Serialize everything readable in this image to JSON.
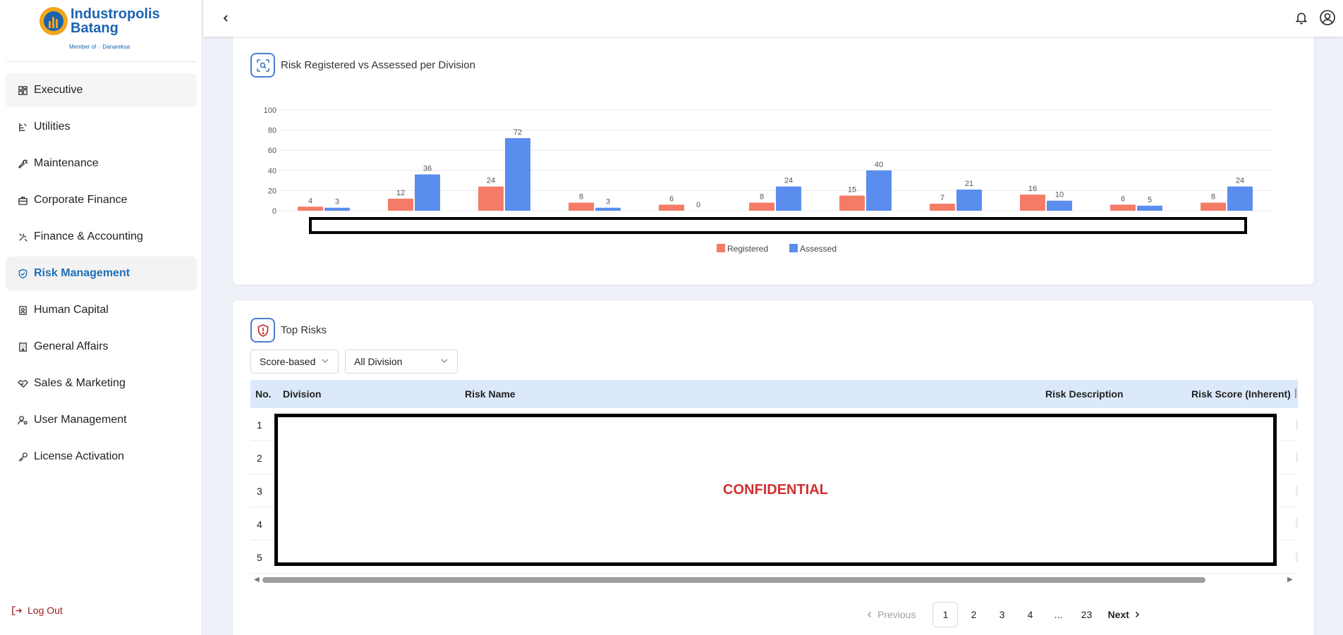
{
  "brand": {
    "name_line1": "Industropolis",
    "name_line2": "Batang",
    "member_of": "Member of ◌ Danareksa"
  },
  "sidebar": {
    "items": [
      {
        "label": "Executive",
        "icon": "grid-icon"
      },
      {
        "label": "Utilities",
        "icon": "utilities-icon"
      },
      {
        "label": "Maintenance",
        "icon": "wrench-icon"
      },
      {
        "label": "Corporate Finance",
        "icon": "briefcase-icon"
      },
      {
        "label": "Finance & Accounting",
        "icon": "tools-icon"
      },
      {
        "label": "Risk Management",
        "icon": "shield-check-icon"
      },
      {
        "label": "Human Capital",
        "icon": "id-badge-icon"
      },
      {
        "label": "General Affairs",
        "icon": "building-icon"
      },
      {
        "label": "Sales & Marketing",
        "icon": "handshake-icon"
      },
      {
        "label": "User Management",
        "icon": "user-cog-icon"
      },
      {
        "label": "License Activation",
        "icon": "key-icon"
      }
    ],
    "active_index": 5,
    "logout_label": "Log Out"
  },
  "chart_card": {
    "title": "Risk Registered vs Assessed per Division"
  },
  "chart_data": {
    "type": "bar",
    "title": "Risk Registered vs Assessed per Division",
    "categories": [
      "",
      "",
      "",
      "",
      "",
      "",
      "",
      "",
      "",
      "",
      ""
    ],
    "series": [
      {
        "name": "Registered",
        "color": "#f47c67",
        "values": [
          4,
          12,
          24,
          8,
          6,
          8,
          15,
          7,
          16,
          6,
          8
        ]
      },
      {
        "name": "Assessed",
        "color": "#5b8def",
        "values": [
          3,
          36,
          72,
          3,
          0,
          24,
          40,
          21,
          10,
          5,
          24
        ]
      }
    ],
    "yticks": [
      0,
      20,
      40,
      60,
      80,
      100
    ],
    "ylim": [
      0,
      100
    ],
    "grid": true,
    "legend": "bottom-center",
    "xlabel": "",
    "ylabel": ""
  },
  "top_risks": {
    "title": "Top Risks",
    "filter_sort": "Score-based",
    "filter_division": "All Division",
    "columns": [
      "No.",
      "Division",
      "Risk Name",
      "Risk Description",
      "Risk Score (Inherent)"
    ],
    "rows": [
      "1",
      "2",
      "3",
      "4",
      "5"
    ],
    "redaction_label": "CONFIDENTIAL",
    "pagination": {
      "previous": "Previous",
      "pages": [
        "1",
        "2",
        "3",
        "4",
        "...",
        "23"
      ],
      "next": "Next",
      "current": "1"
    }
  }
}
